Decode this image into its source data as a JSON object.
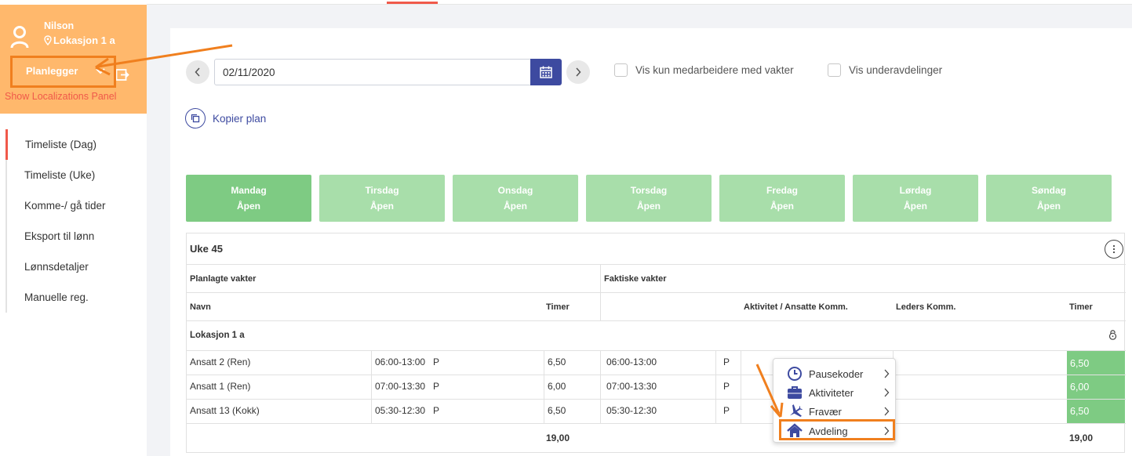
{
  "profile": {
    "name": "Nilson",
    "location": "Lokasjon 1 a",
    "role": "Planlegger",
    "show_localizations": "Show Localizations Panel"
  },
  "sidebar": {
    "items": [
      {
        "label": "Timeliste (Dag)",
        "active": true
      },
      {
        "label": "Timeliste (Uke)"
      },
      {
        "label": "Komme-/ gå tider"
      },
      {
        "label": "Eksport til lønn"
      },
      {
        "label": "Lønnsdetaljer"
      },
      {
        "label": "Manuelle reg."
      }
    ]
  },
  "toolbar": {
    "date": "02/11/2020",
    "only_with_shifts": "Vis kun medarbeidere med vakter",
    "show_subdepartments": "Vis underavdelinger",
    "copy_plan": "Kopier plan"
  },
  "days": [
    {
      "name": "Mandag",
      "status": "Åpen",
      "active": true
    },
    {
      "name": "Tirsdag",
      "status": "Åpen"
    },
    {
      "name": "Onsdag",
      "status": "Åpen"
    },
    {
      "name": "Torsdag",
      "status": "Åpen"
    },
    {
      "name": "Fredag",
      "status": "Åpen"
    },
    {
      "name": "Lørdag",
      "status": "Åpen"
    },
    {
      "name": "Søndag",
      "status": "Åpen"
    }
  ],
  "table": {
    "week": "Uke 45",
    "planned_header": "Planlagte vakter",
    "actual_header": "Faktiske vakter",
    "col_name": "Navn",
    "col_hours": "Timer",
    "col_activity": "Aktivitet / Ansatte Komm.",
    "col_leader": "Leders Komm.",
    "col_hours_actual": "Timer",
    "group": "Lokasjon 1 a",
    "rows": [
      {
        "name": "Ansatt 2 (Ren)",
        "planned_time": "06:00-13:00",
        "planned_code": "P",
        "planned_hours": "6,50",
        "actual_time": "06:00-13:00",
        "actual_code": "P",
        "actual_hours": "6,50"
      },
      {
        "name": "Ansatt 1 (Ren)",
        "planned_time": "07:00-13:30",
        "planned_code": "P",
        "planned_hours": "6,00",
        "actual_time": "07:00-13:30",
        "actual_code": "P",
        "actual_hours": "6,00"
      },
      {
        "name": "Ansatt 13 (Kokk)",
        "planned_time": "05:30-12:30",
        "planned_code": "P",
        "planned_hours": "6,50",
        "actual_time": "05:30-12:30",
        "actual_code": "P",
        "actual_hours": "6,50"
      }
    ],
    "total_planned": "19,00",
    "total_actual": "19,00"
  },
  "context_menu": {
    "items": [
      {
        "label": "Pausekoder",
        "icon": "clock-icon"
      },
      {
        "label": "Aktiviteter",
        "icon": "briefcase-icon"
      },
      {
        "label": "Fravær",
        "icon": "plane-icon"
      },
      {
        "label": "Avdeling",
        "icon": "house-icon"
      }
    ]
  },
  "colors": {
    "profile_bg": "#ffb86c",
    "accent": "#f0594a",
    "primary": "#3d4aa0",
    "green": "#7ecb83",
    "green_light": "#a8deaa",
    "annotation": "#f07f1e"
  }
}
